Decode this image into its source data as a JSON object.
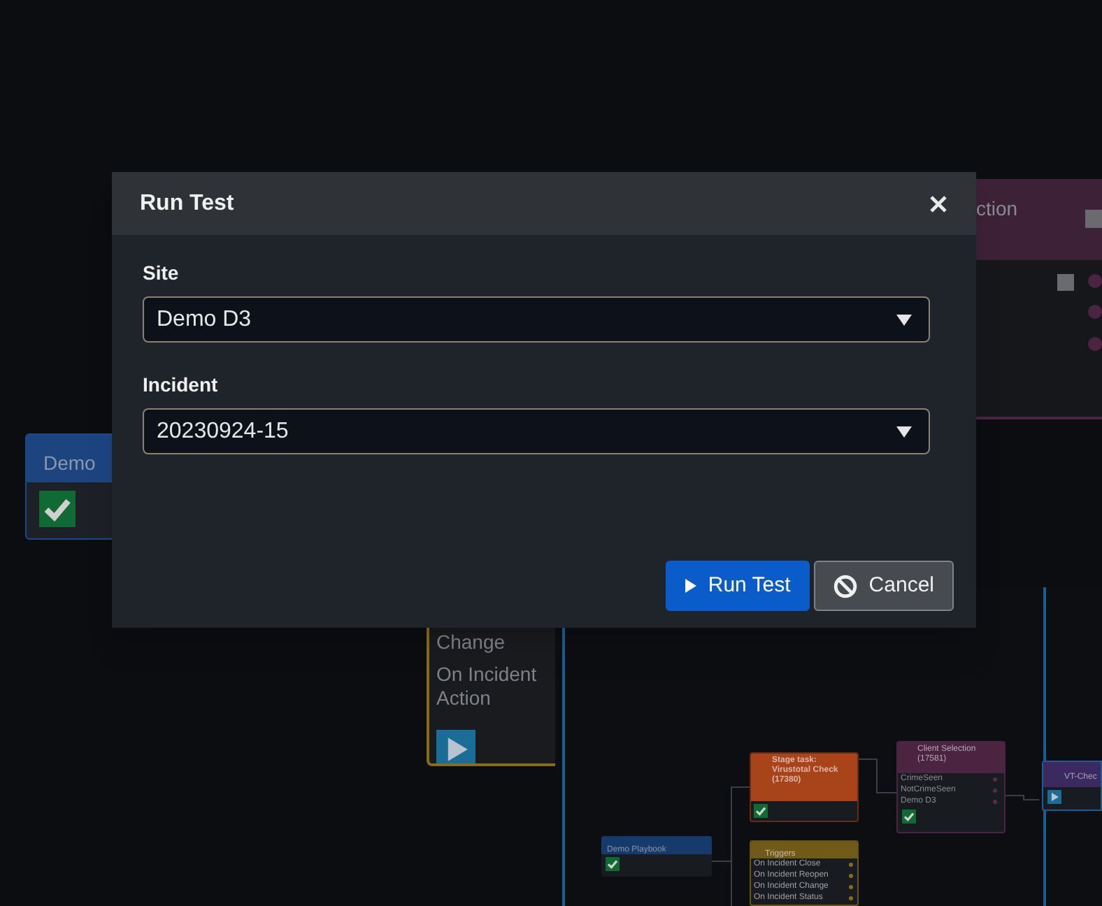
{
  "canvas": {
    "nodes": [
      {
        "kind": "playbook",
        "title": "Demo"
      },
      {
        "kind": "trigger",
        "lines": [
          "Change",
          "On Incident",
          "Action"
        ]
      },
      {
        "kind": "selection",
        "title": "ction"
      },
      {
        "kind": "mini-playbook",
        "title": "Demo Playbook"
      },
      {
        "kind": "task",
        "title": "Stage task: Virustotal Check (17380)"
      },
      {
        "kind": "triggers",
        "title": "Triggers",
        "lines": [
          "On Incident Close",
          "On Incident Reopen",
          "On Incident Change",
          "On Incident Status"
        ]
      },
      {
        "kind": "client",
        "title": "Client Selection (17581)",
        "lines": [
          "CrimeSeen",
          "NotCrimeSeen",
          "Demo D3"
        ]
      },
      {
        "kind": "check",
        "title": "VT-Chec"
      }
    ]
  },
  "dialog": {
    "title": "Run Test",
    "fields": [
      {
        "label": "Site",
        "value": "Demo D3"
      },
      {
        "label": "Incident",
        "value": "20230924-15"
      }
    ],
    "buttons": [
      {
        "label": "Run Test",
        "kind": "primary"
      },
      {
        "label": "Cancel",
        "kind": "secondary"
      }
    ]
  }
}
